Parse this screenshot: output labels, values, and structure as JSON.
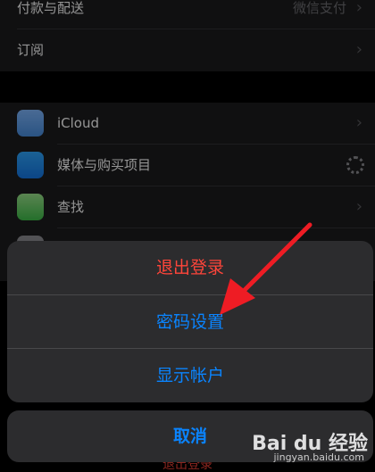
{
  "settings": {
    "payment": {
      "label": "付款与配送",
      "value": "微信支付"
    },
    "subscription": {
      "label": "订阅"
    },
    "services": [
      {
        "label": "iCloud",
        "icon": "icloud-icon",
        "accessory": "chevron"
      },
      {
        "label": "媒体与购买项目",
        "icon": "app-store-icon",
        "accessory": "spinner"
      },
      {
        "label": "查找",
        "icon": "find-my-icon",
        "accessory": "chevron"
      }
    ]
  },
  "action_sheet": {
    "actions": [
      {
        "label": "退出登录",
        "style": "destructive",
        "color": "#ff453a"
      },
      {
        "label": "密码设置",
        "style": "default",
        "color": "#0a84ff"
      },
      {
        "label": "显示帐户",
        "style": "default",
        "color": "#0a84ff"
      }
    ],
    "cancel_label": "取消"
  },
  "below_sheet_text": "退出登录",
  "watermark": {
    "main": "Bai du 经验",
    "sub": "jingyan.baidu.com"
  }
}
